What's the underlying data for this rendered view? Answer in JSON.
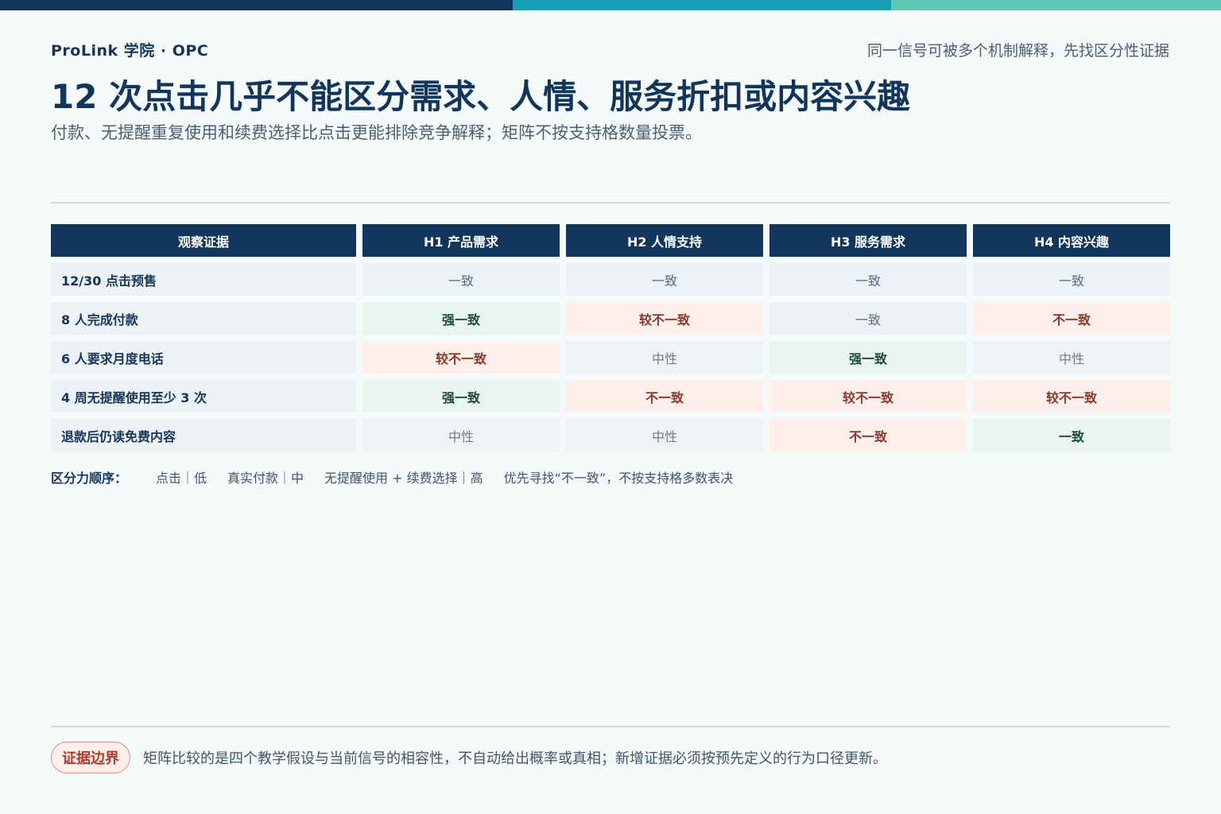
{
  "colors": {
    "navy": "#12365b",
    "teal": "#15a0b8",
    "mint": "#5fc7b2",
    "strong_bg": "#e9f5f0",
    "bad_bg": "#fdefeb"
  },
  "header": {
    "brand": "ProLink 学院 · OPC",
    "tagline": "同一信号可被多个机制解释，先找区分性证据",
    "title": "12 次点击几乎不能区分需求、人情、服务折扣或内容兴趣",
    "subtitle": "付款、无提醒重复使用和续费选择比点击更能排除竞争解释；矩阵不按支持格数量投票。"
  },
  "matrix": {
    "headers": [
      "观察证据",
      "H1 产品需求",
      "H2 人情支持",
      "H3 服务需求",
      "H4 内容兴趣"
    ],
    "rows": [
      {
        "evidence": "12/30 点击预售",
        "cells": [
          "一致",
          "一致",
          "一致",
          "一致"
        ],
        "styles": [
          "neutral",
          "neutral",
          "neutral",
          "neutral"
        ]
      },
      {
        "evidence": "8 人完成付款",
        "cells": [
          "强一致",
          "较不一致",
          "一致",
          "不一致"
        ],
        "styles": [
          "strong",
          "bad",
          "neutral",
          "bad"
        ]
      },
      {
        "evidence": "6 人要求月度电话",
        "cells": [
          "较不一致",
          "中性",
          "强一致",
          "中性"
        ],
        "styles": [
          "bad",
          "gray",
          "strong",
          "gray"
        ]
      },
      {
        "evidence": "4 周无提醒使用至少 3 次",
        "cells": [
          "强一致",
          "不一致",
          "较不一致",
          "较不一致"
        ],
        "styles": [
          "strong",
          "bad",
          "bad",
          "bad"
        ]
      },
      {
        "evidence": "退款后仍读免费内容",
        "cells": [
          "中性",
          "中性",
          "不一致",
          "一致"
        ],
        "styles": [
          "gray",
          "gray",
          "bad",
          "strong"
        ]
      }
    ]
  },
  "order": {
    "label": "区分力顺序：",
    "items": [
      "点击｜低",
      "真实付款｜中",
      "无提醒使用 + 续费选择｜高",
      "优先寻找“不一致”，不按支持格多数表决"
    ]
  },
  "footer": {
    "badge": "证据边界",
    "note": "矩阵比较的是四个教学假设与当前信号的相容性，不自动给出概率或真相；新增证据必须按预先定义的行为口径更新。"
  }
}
